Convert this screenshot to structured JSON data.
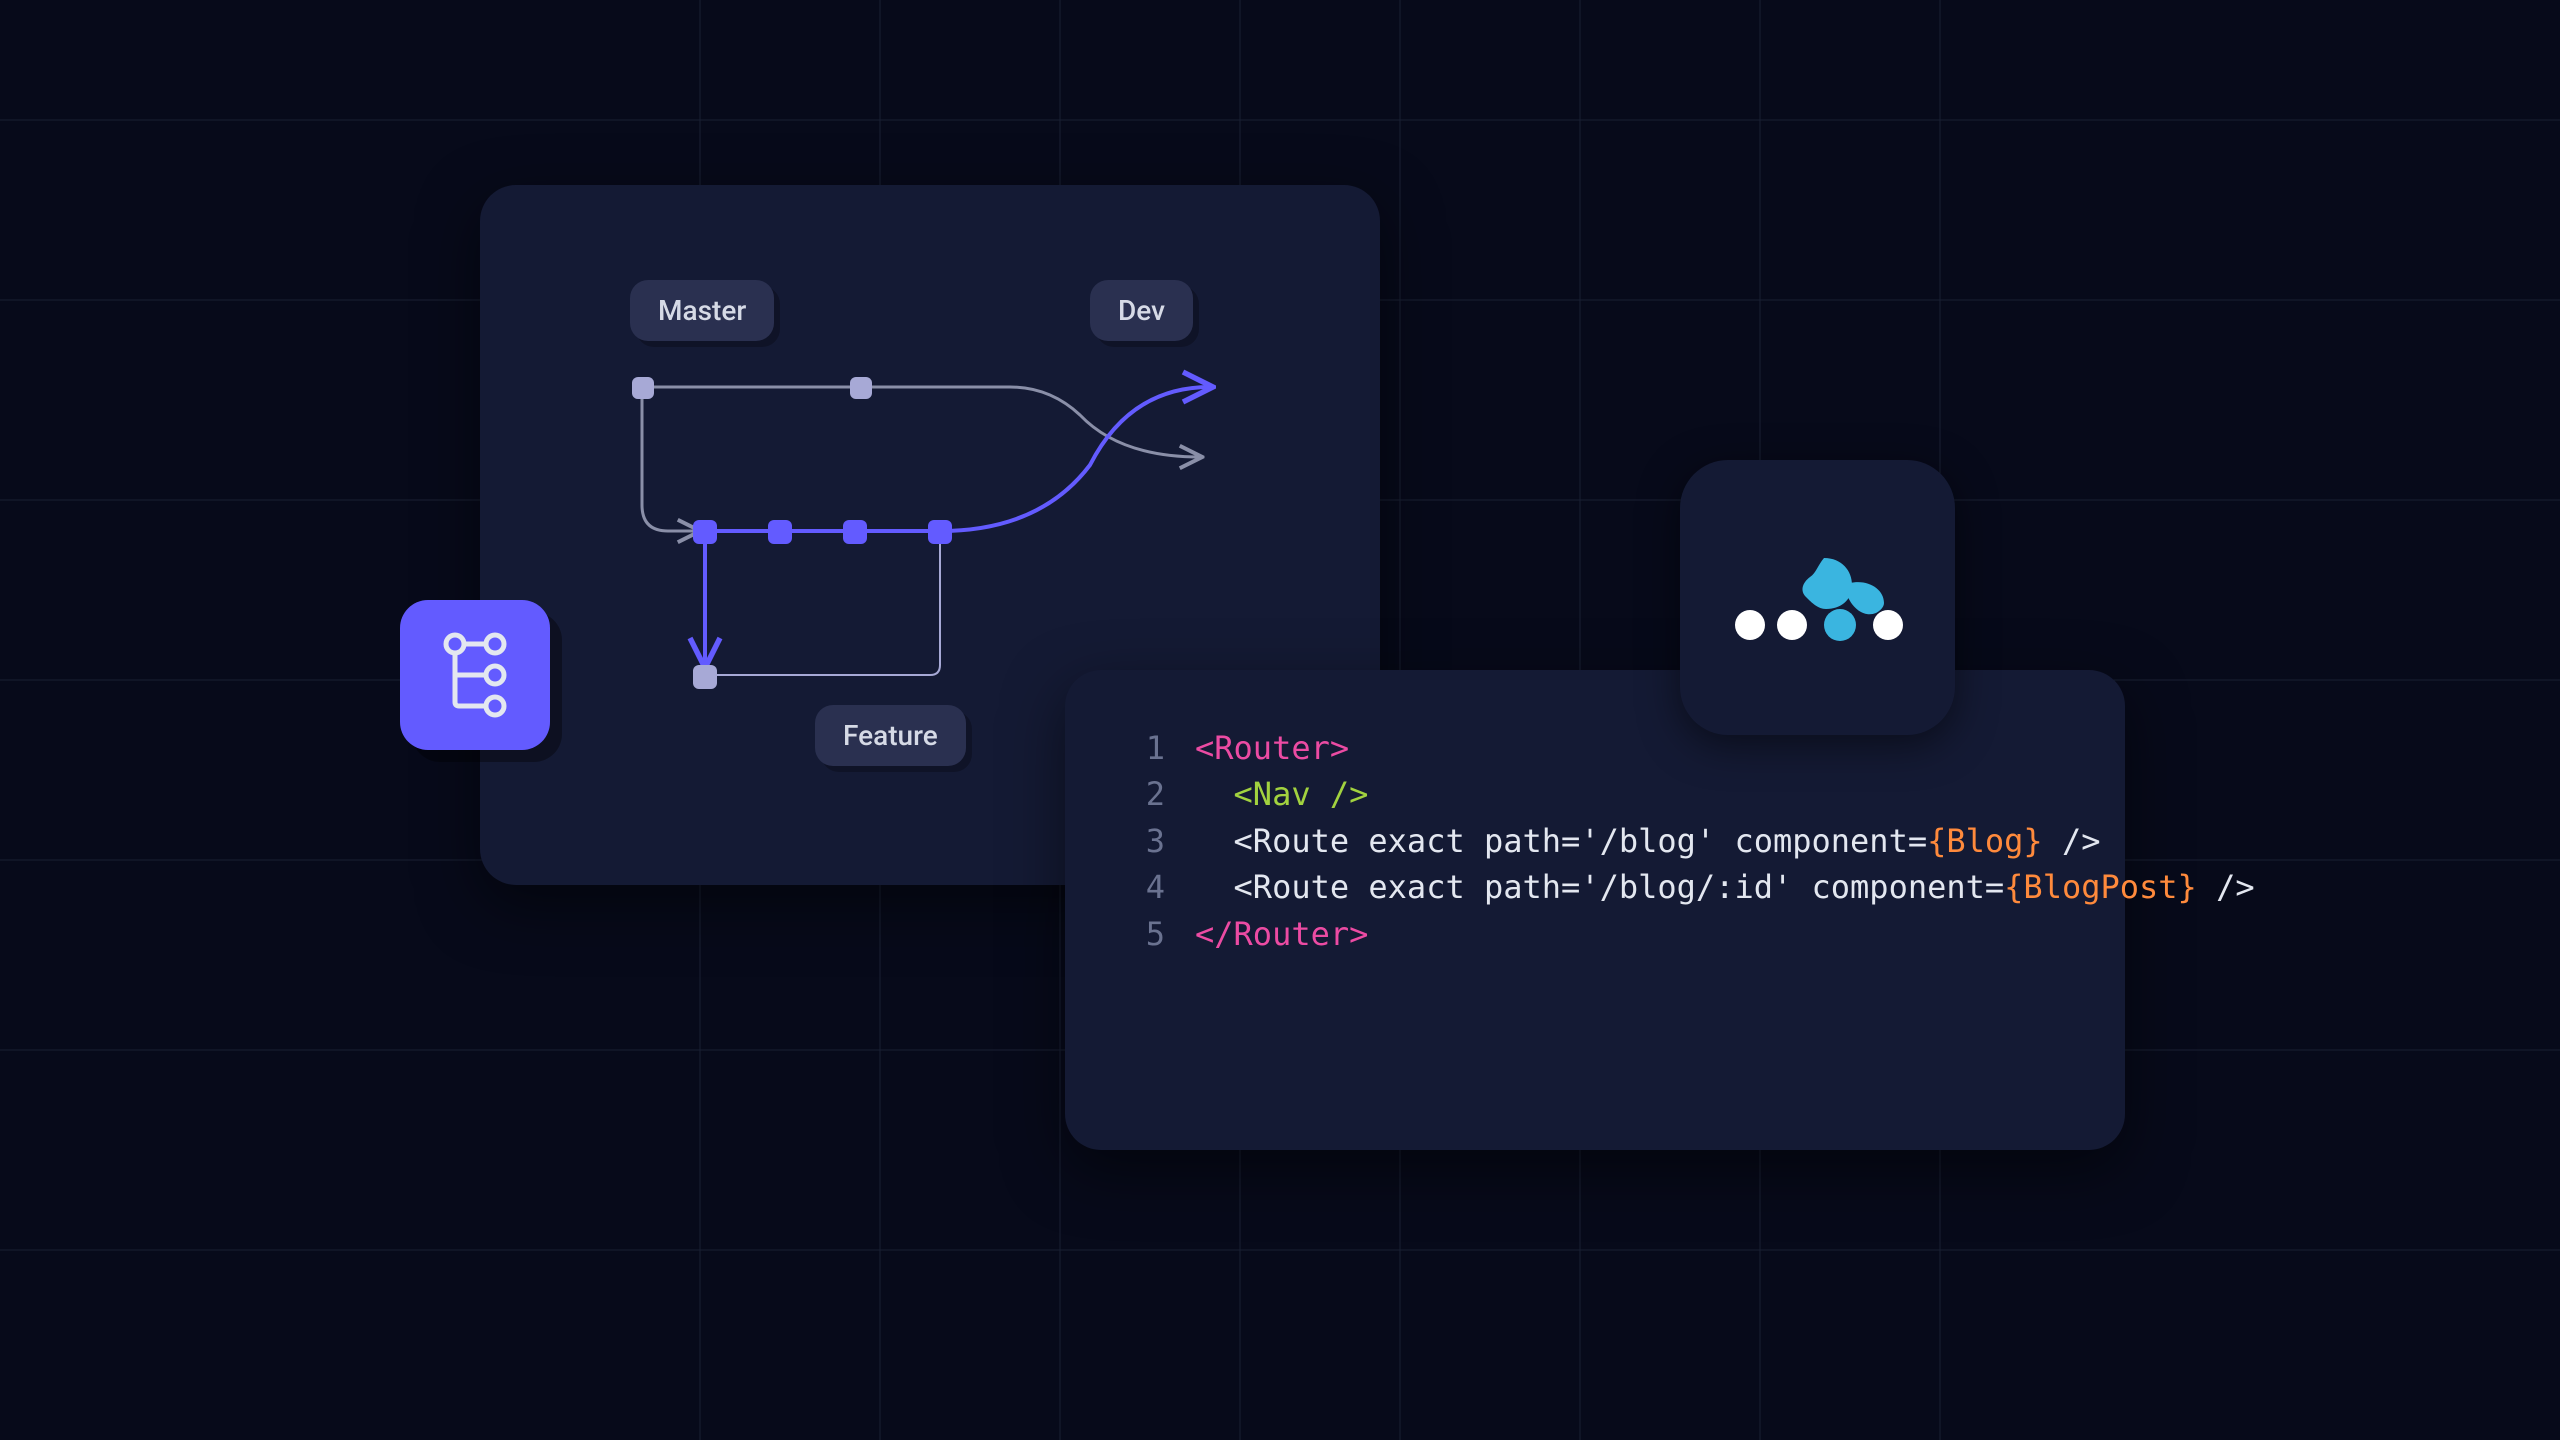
{
  "git_panel": {
    "branches": {
      "master": "Master",
      "dev": "Dev",
      "feature": "Feature"
    }
  },
  "code_panel": {
    "lines": [
      {
        "n": "1",
        "indent": "",
        "segments": [
          {
            "cls": "tok-pink",
            "text": "<Router>"
          }
        ]
      },
      {
        "n": "2",
        "indent": "  ",
        "segments": [
          {
            "cls": "tok-green",
            "text": "<Nav />"
          }
        ]
      },
      {
        "n": "3",
        "indent": "  ",
        "segments": [
          {
            "cls": "tok-white",
            "text": "<Route exact path='/blog' component="
          },
          {
            "cls": "tok-orange",
            "text": "{Blog}"
          },
          {
            "cls": "tok-white",
            "text": " />"
          }
        ]
      },
      {
        "n": "4",
        "indent": "  ",
        "segments": [
          {
            "cls": "tok-white",
            "text": "<Route exact path='/blog/:id' component="
          },
          {
            "cls": "tok-orange",
            "text": "{BlogPost}"
          },
          {
            "cls": "tok-white",
            "text": " />"
          }
        ]
      },
      {
        "n": "5",
        "indent": "",
        "segments": [
          {
            "cls": "tok-pink",
            "text": "</Router>"
          }
        ]
      }
    ]
  },
  "icons": {
    "git_branch": "git-branch-icon",
    "router_logo": "react-router-logo"
  },
  "colors": {
    "bg": "#070a1a",
    "panel": "#141a34",
    "badge_bg": "#2a3050",
    "badge_text": "#d6dae6",
    "accent_purple": "#635bff",
    "accent_light": "#a7a9d6",
    "gutter": "#6a7290",
    "pink": "#ec4ba3",
    "green": "#a2d23f",
    "white": "#e3e7f0",
    "orange": "#ff8a3c",
    "logo_cyan": "#3ab5e0",
    "logo_white": "#ffffff"
  }
}
